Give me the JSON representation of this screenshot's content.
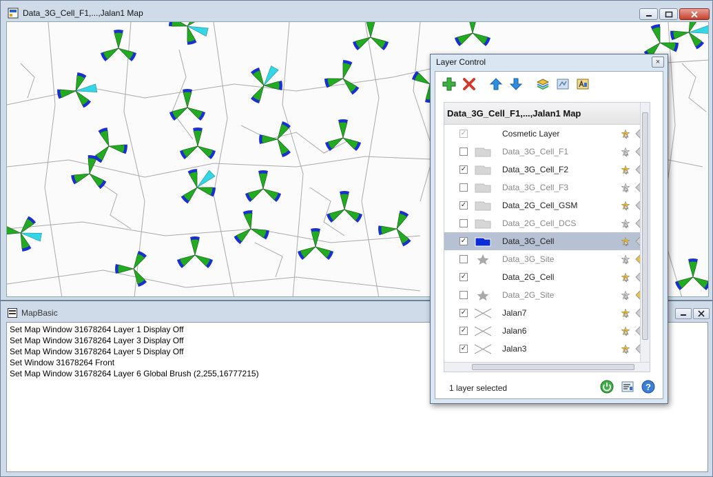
{
  "map_window": {
    "title": "Data_3G_Cell_F1,...,Jalan1 Map"
  },
  "mapbasic": {
    "title": "MapBasic",
    "lines": [
      "Set Map Window 31678264  Layer 1 Display Off",
      "Set Map Window 31678264  Layer 3 Display Off",
      "Set Map Window 31678264  Layer 5 Display Off",
      "Set Window 31678264 Front",
      "Set Map Window 31678264  Layer 6 Global Brush (2,255,16777215)"
    ]
  },
  "layer_control": {
    "title": "Layer Control",
    "close_label": "×",
    "map_name": "Data_3G_Cell_F1,...,Jalan1 Map",
    "layers": [
      {
        "name": "Cosmetic Layer",
        "checked": true,
        "disabled": true,
        "symbol": "none",
        "dim": false
      },
      {
        "name": "Data_3G_Cell_F1",
        "checked": false,
        "symbol": "region",
        "dim": true
      },
      {
        "name": "Data_3G_Cell_F2",
        "checked": true,
        "symbol": "region",
        "dim": false
      },
      {
        "name": "Data_3G_Cell_F3",
        "checked": false,
        "symbol": "region",
        "dim": true
      },
      {
        "name": "Data_2G_Cell_GSM",
        "checked": true,
        "symbol": "region",
        "dim": false
      },
      {
        "name": "Data_2G_Cell_DCS",
        "checked": false,
        "symbol": "region",
        "dim": true
      },
      {
        "name": "Data_3G_Cell",
        "checked": true,
        "symbol": "region-blue",
        "dim": false,
        "selected": true
      },
      {
        "name": "Data_3G_Site",
        "checked": false,
        "symbol": "star",
        "dim": true
      },
      {
        "name": "Data_2G_Cell",
        "checked": true,
        "symbol": "none",
        "dim": false
      },
      {
        "name": "Data_2G_Site",
        "checked": false,
        "symbol": "star",
        "dim": true
      },
      {
        "name": "Jalan7",
        "checked": true,
        "symbol": "line",
        "dim": false
      },
      {
        "name": "Jalan6",
        "checked": true,
        "symbol": "line",
        "dim": false
      },
      {
        "name": "Jalan3",
        "checked": true,
        "symbol": "line",
        "dim": false
      }
    ],
    "status": "1 layer selected",
    "colors": {
      "selected_row": "#b6c2d4",
      "sector_green": "#22aa22",
      "sector_blue": "#1a2fd6",
      "sector_cyan": "#34d6e6"
    }
  }
}
